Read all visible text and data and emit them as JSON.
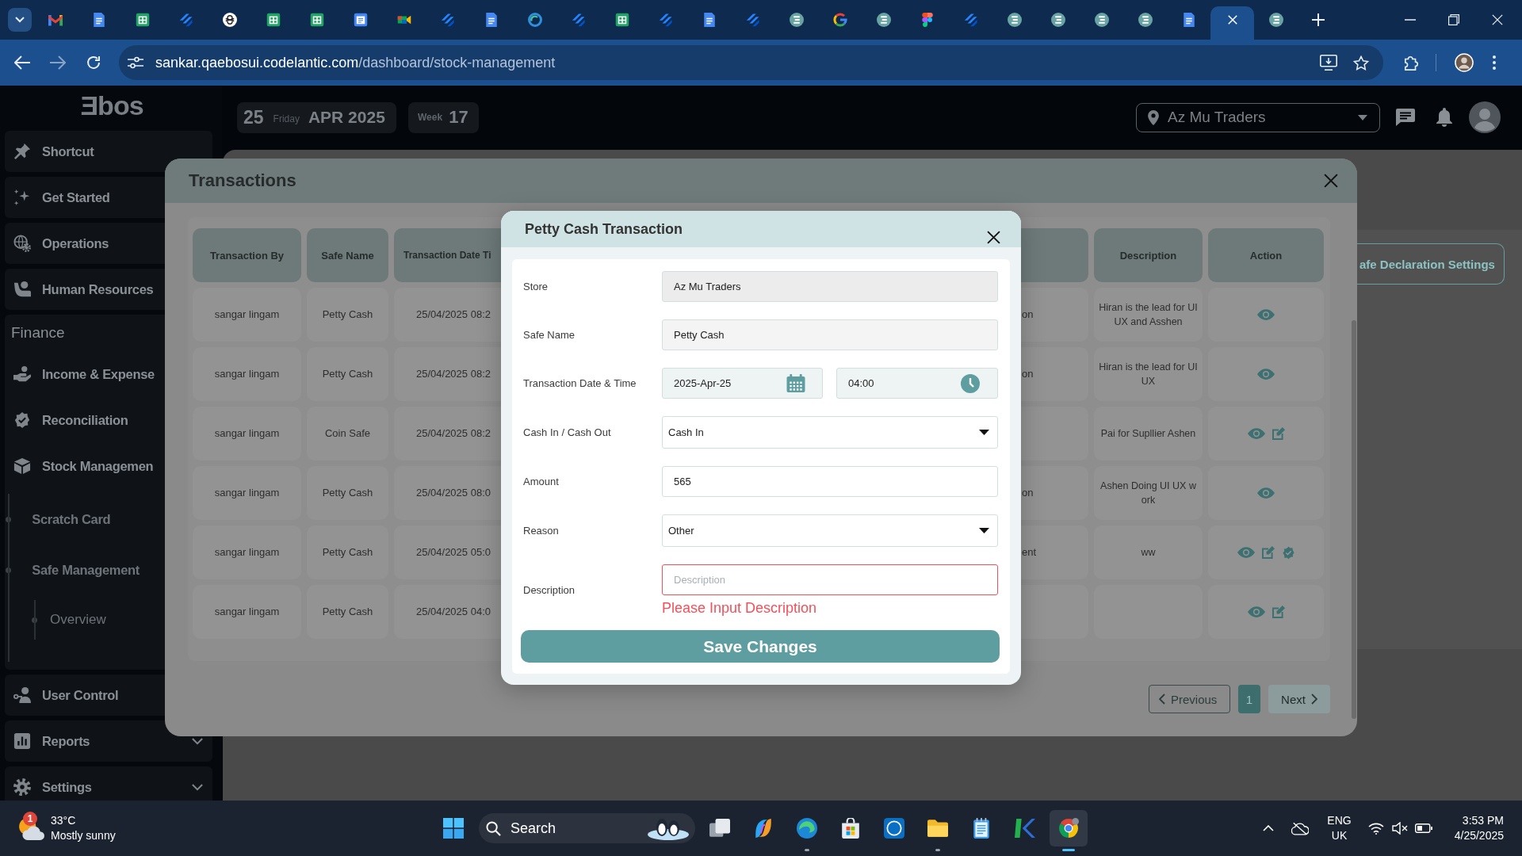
{
  "browser": {
    "tabs": [
      {
        "kind": "mail",
        "selected": false
      },
      {
        "kind": "document",
        "selected": false
      },
      {
        "kind": "sheet",
        "selected": false
      },
      {
        "kind": "tracker",
        "selected": false
      },
      {
        "kind": "chat",
        "selected": false
      },
      {
        "kind": "sheet",
        "selected": false
      },
      {
        "kind": "sheet",
        "selected": false
      },
      {
        "kind": "calendar",
        "selected": false
      },
      {
        "kind": "meeting",
        "selected": false
      },
      {
        "kind": "tracker",
        "selected": false
      },
      {
        "kind": "document",
        "selected": false
      },
      {
        "kind": "swirl",
        "selected": false
      },
      {
        "kind": "tracker",
        "selected": false
      },
      {
        "kind": "sheet",
        "selected": false
      },
      {
        "kind": "tracker",
        "selected": false
      },
      {
        "kind": "document",
        "selected": false
      },
      {
        "kind": "tracker",
        "selected": false
      },
      {
        "kind": "logo",
        "selected": false
      },
      {
        "kind": "search",
        "selected": false
      },
      {
        "kind": "logo",
        "selected": false
      },
      {
        "kind": "design",
        "selected": false
      },
      {
        "kind": "tracker",
        "selected": false
      },
      {
        "kind": "logo",
        "selected": false
      },
      {
        "kind": "logo",
        "selected": false
      },
      {
        "kind": "logo",
        "selected": false
      },
      {
        "kind": "logo",
        "selected": false
      },
      {
        "kind": "document",
        "selected": false
      },
      {
        "selected": true
      },
      {
        "kind": "logo",
        "selected": false
      }
    ],
    "address": {
      "host": "sankar.qaebosui.codelantic.com",
      "path": "/dashboard/stock-management"
    }
  },
  "header": {
    "date": {
      "day": "25",
      "weekday": "Friday",
      "month_year": "APR 2025"
    },
    "week": {
      "label": "Week",
      "number": "17"
    },
    "store_selector": {
      "value": "Az Mu Traders"
    }
  },
  "sidebar": {
    "logo": "Ǝbos",
    "items": [
      {
        "kind": "link",
        "label": "Shortcut"
      },
      {
        "kind": "link",
        "label": "Get Started"
      },
      {
        "kind": "link",
        "label": "Operations"
      },
      {
        "kind": "link",
        "label": "Human Resources"
      },
      {
        "kind": "group",
        "label": "Finance",
        "children": [
          {
            "label": "Income & Expense"
          },
          {
            "label": "Reconciliation"
          },
          {
            "label": "Stock Managemen",
            "children": [
              {
                "label": "Scratch Card"
              },
              {
                "label": "Safe Management",
                "children": [
                  {
                    "label": "Overview"
                  }
                ]
              }
            ]
          }
        ]
      },
      {
        "kind": "link",
        "label": "User Control"
      },
      {
        "kind": "menu",
        "label": "Reports"
      },
      {
        "kind": "menu",
        "label": "Settings"
      }
    ]
  },
  "page": {
    "settings_button": "afe Declaration Settings"
  },
  "transactions_dialog": {
    "title": "Transactions",
    "columns": [
      "Transaction By",
      "Safe Name",
      "Transaction Date Ti",
      "Description",
      "Action"
    ],
    "rows": [
      {
        "transaction_by": "sangar lingam",
        "safe_name": "Petty Cash",
        "transaction_date_time": "25/04/2025 08:2",
        "column_4": "on",
        "description": "Hiran is the lead for UI UX and Asshen",
        "actions": [
          {
            "kind": "view"
          }
        ]
      },
      {
        "transaction_by": "sangar lingam",
        "safe_name": "Petty Cash",
        "transaction_date_time": "25/04/2025 08:2",
        "column_4": "on",
        "description": "Hiran is the lead for UI UX",
        "actions": [
          {
            "kind": "view"
          }
        ]
      },
      {
        "transaction_by": "sangar lingam",
        "safe_name": "Coin Safe",
        "transaction_date_time": "25/04/2025 08:2",
        "description": "Pai for Supllier Ashen",
        "actions": [
          {
            "kind": "view"
          },
          {
            "kind": "edit"
          }
        ]
      },
      {
        "transaction_by": "sangar lingam",
        "safe_name": "Petty Cash",
        "transaction_date_time": "25/04/2025 08:0",
        "column_4": "on",
        "description": "Ashen Doing UI UX work",
        "actions": [
          {
            "kind": "view"
          }
        ]
      },
      {
        "transaction_by": "sangar lingam",
        "safe_name": "Petty Cash",
        "transaction_date_time": "25/04/2025 05:0",
        "column_4": "ent",
        "description": "ww",
        "actions": [
          {
            "kind": "view"
          },
          {
            "kind": "edit"
          },
          {
            "kind": "approve"
          }
        ]
      },
      {
        "transaction_by": "sangar lingam",
        "safe_name": "Petty Cash",
        "transaction_date_time": "25/04/2025 04:0",
        "actions": [
          {
            "kind": "view"
          },
          {
            "kind": "edit"
          }
        ]
      }
    ],
    "pagination": {
      "previous": "Previous",
      "pages": [
        {
          "label": "1",
          "selected": true
        }
      ],
      "next": "Next"
    }
  },
  "petty_cash_dialog": {
    "title": "Petty Cash Transaction",
    "fields": [
      {
        "label": "Store",
        "kind": "disabled",
        "value": "Az Mu Traders"
      },
      {
        "label": "Safe Name",
        "kind": "readonly",
        "value": "Petty Cash"
      },
      {
        "label": "Transaction Date & Time",
        "kind": "datetime",
        "date": "2025-Apr-25",
        "time": "04:00"
      },
      {
        "label": "Cash In / Cash Out",
        "kind": "select",
        "value": "Cash In"
      },
      {
        "label": "Amount",
        "kind": "text",
        "value": "565"
      },
      {
        "label": "Reason",
        "kind": "select",
        "value": "Other"
      },
      {
        "label": "Description",
        "kind": "text",
        "placeholder": "Description",
        "error": "Please Input Description"
      }
    ],
    "save_button": "Save Changes"
  },
  "taskbar": {
    "weather": {
      "badge": "1",
      "temperature": "33°C",
      "condition": "Mostly sunny"
    },
    "search": {
      "label": "Search"
    },
    "apps": [
      {
        "kind": "taskview",
        "running": false,
        "selected": false
      },
      {
        "kind": "assistant",
        "running": false,
        "selected": false
      },
      {
        "kind": "edge",
        "running": true,
        "selected": false
      },
      {
        "kind": "store",
        "running": false,
        "selected": false
      },
      {
        "kind": "support",
        "running": false,
        "selected": false
      },
      {
        "kind": "folder",
        "running": true,
        "selected": false
      },
      {
        "kind": "notepad",
        "running": false,
        "selected": false
      },
      {
        "kind": "kmark",
        "running": false,
        "selected": false
      },
      {
        "kind": "chrome",
        "running": true,
        "selected": true
      }
    ],
    "tray": {
      "language": "ENG",
      "region": "UK",
      "time": "3:53 PM",
      "date": "4/25/2025"
    }
  }
}
